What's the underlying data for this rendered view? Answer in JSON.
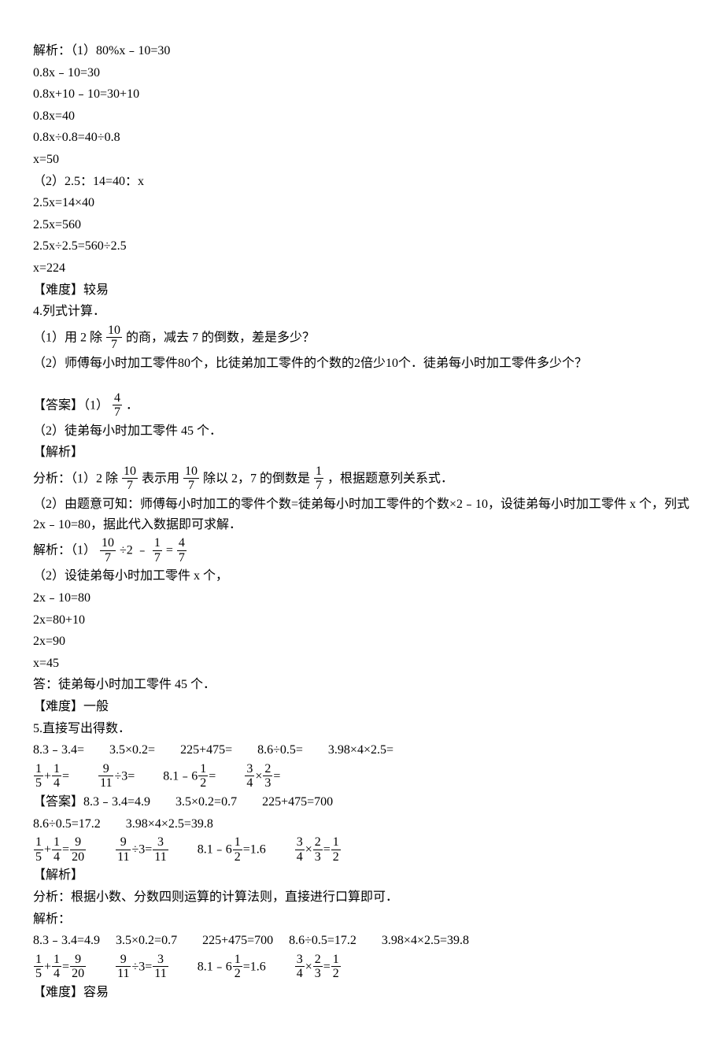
{
  "l1": "解析：（1）80%x﹣10=30",
  "l2": "0.8x﹣10=30",
  "l3": "0.8x+10﹣10=30+10",
  "l4": "0.8x=40",
  "l5": "0.8x÷0.8=40÷0.8",
  "l6": "x=50",
  "l7": "（2）2.5：14=40：x",
  "l8": "2.5x=14×40",
  "l9": "2.5x=560",
  "l10": "2.5x÷2.5=560÷2.5",
  "l11": "x=224",
  "l12": "【难度】较易",
  "l13": "4.列式计算．",
  "q1a": "（1）用 2 除",
  "q1b": "的商，减去 7 的倒数，差是多少？",
  "q2": "（2）师傅每小时加工零件80个，比徒弟加工零件的个数的2倍少10个．徒弟每小时加工零件多少个？",
  "ansLabel": "【答案】（1）",
  "ansPeriod": "．",
  "ans2": "（2）徒弟每小时加工零件 45 个．",
  "jiexi": "【解析】",
  "fx1a": "分析：（1）2 除",
  "fx1b": "表示用",
  "fx1c": "除以 2，7 的倒数是",
  "fx1d": "，根据题意列关系式．",
  "fx2": "（2）由题意可知：师傅每小时加工的零件个数=徒弟每小时加工零件的个数×2﹣10，设徒弟每小时加工零件 x 个，列式 2x﹣10=80，据此代入数据即可求解．",
  "jx1a": "解析：（1）",
  "jx1b": "÷2 ﹣",
  "jx1c": " = ",
  "jx2": "（2）设徒弟每小时加工零件 x 个，",
  "eq1": "2x﹣10=80",
  "eq2": "2x=80+10",
  "eq3": "2x=90",
  "eq4": "x=45",
  "ansLine": "答：徒弟每小时加工零件 45 个．",
  "diff2": "【难度】一般",
  "q5": "5.直接写出得数．",
  "q5row1": "8.3﹣3.4=　　3.5×0.2=　　225+475=　　8.6÷0.5=　　3.98×4×2.5=",
  "f1a": "+",
  "f1b": "=",
  "f2a": "÷3=",
  "f3a": "8.1﹣6",
  "f3b": "=",
  "f4a": "×",
  "f4b": "=",
  "ans5h": "【答案】8.3﹣3.4=4.9　　3.5×0.2=0.7　　225+475=700",
  "ans5r2": "8.6÷0.5=17.2　　3.98×4×2.5=39.8",
  "af1a": "+",
  "af1b": "=",
  "af2a": "÷3=",
  "af3a": "8.1﹣6",
  "af3b": "=1.6",
  "af4a": "×",
  "af4b": "=",
  "jiexi2": "【解析】",
  "fx5": "分析：根据小数、分数四则运算的计算法则，直接进行口算即可．",
  "jx5": "解析：",
  "jx5r1": "8.3﹣3.4=4.9　 3.5×0.2=0.7　　225+475=700　 8.6÷0.5=17.2　　3.98×4×2.5=39.8",
  "diff3": "【难度】容易",
  "n1": "1",
  "n2": "2",
  "n3": "3",
  "n4": "4",
  "n5": "5",
  "n7": "7",
  "n9": "9",
  "n10": "10",
  "n11": "11",
  "n20": "20"
}
